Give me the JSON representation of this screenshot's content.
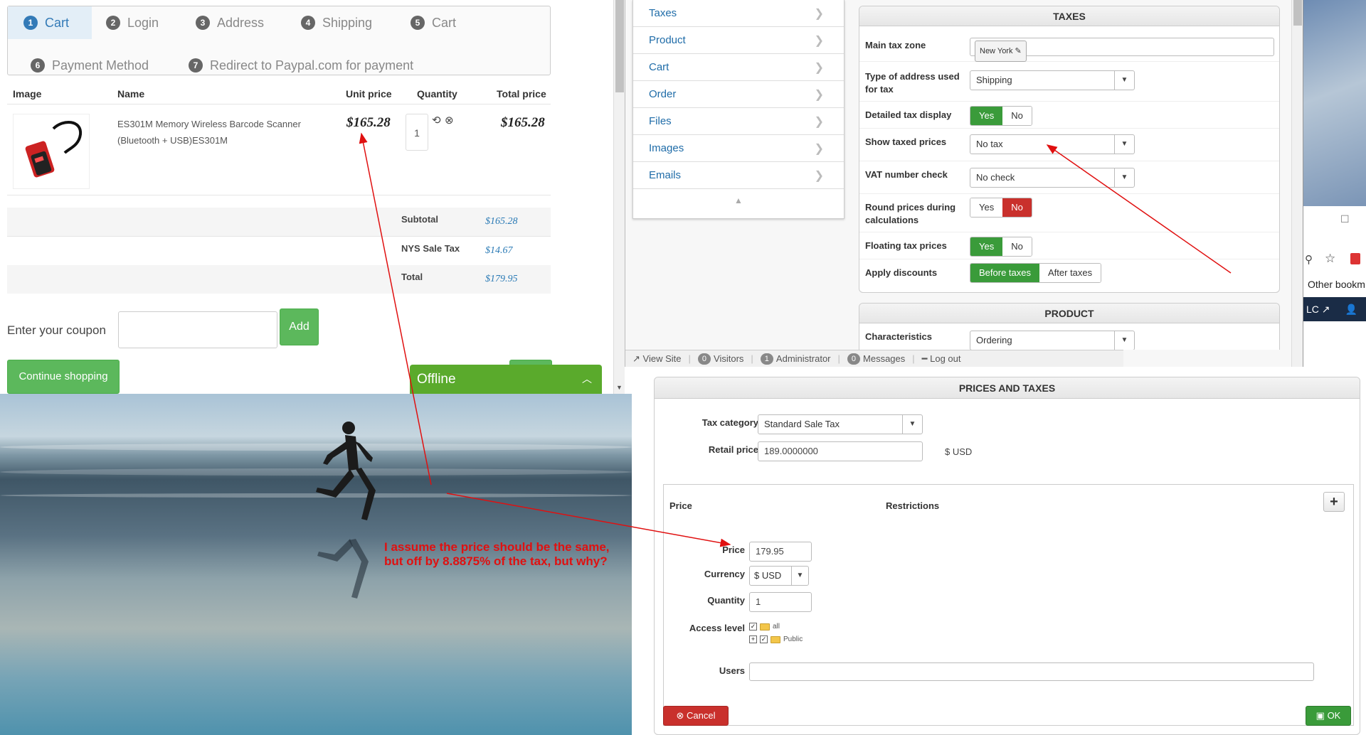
{
  "cart": {
    "steps": [
      {
        "num": "1",
        "label": "Cart"
      },
      {
        "num": "2",
        "label": "Login"
      },
      {
        "num": "3",
        "label": "Address"
      },
      {
        "num": "4",
        "label": "Shipping"
      },
      {
        "num": "5",
        "label": "Cart"
      },
      {
        "num": "6",
        "label": "Payment Method"
      },
      {
        "num": "7",
        "label": "Redirect to Paypal.com for payment"
      }
    ],
    "columns": {
      "image": "Image",
      "name": "Name",
      "unit_price": "Unit price",
      "quantity": "Quantity",
      "total_price": "Total price"
    },
    "item": {
      "name": "ES301M Memory Wireless Barcode Scanner (Bluetooth + USB)ES301M",
      "unit_price": "$165.28",
      "quantity": "1",
      "total_price": "$165.28"
    },
    "summary": {
      "subtotal_label": "Subtotal",
      "subtotal": "$165.28",
      "tax_label": "NYS Sale Tax",
      "tax": "$14.67",
      "total_label": "Total",
      "total": "$179.95"
    },
    "coupon_label": "Enter your coupon",
    "add_button": "Add",
    "continue_button": "Continue shopping",
    "chat_status": "Offline"
  },
  "admin": {
    "menu": [
      "Taxes",
      "Product",
      "Cart",
      "Order",
      "Files",
      "Images",
      "Emails"
    ],
    "taxes_title": "TAXES",
    "main_tax_zone_label": "Main tax zone",
    "main_tax_zone_value": "New York",
    "address_type_label": "Type of address used for tax",
    "address_type_value": "Shipping",
    "detailed_tax_label": "Detailed tax display",
    "show_taxed_label": "Show taxed prices",
    "show_taxed_value": "No tax",
    "vat_label": "VAT number check",
    "vat_value": "No check",
    "round_label": "Round prices during calculations",
    "floating_label": "Floating tax prices",
    "apply_discounts_label": "Apply discounts",
    "yes": "Yes",
    "no": "No",
    "before_taxes": "Before taxes",
    "after_taxes": "After taxes",
    "product_title": "PRODUCT",
    "characteristics_label": "Characteristics",
    "characteristics_value": "Ordering",
    "status_bar": {
      "view_site": "View Site",
      "visitors_count": "0",
      "visitors": "Visitors",
      "admin_count": "1",
      "admin": "Administrator",
      "messages_count": "0",
      "messages": "Messages",
      "logout": "Log out"
    }
  },
  "browser": {
    "bookmarks": "Other bookm",
    "dark_text": "LC"
  },
  "prices": {
    "title": "PRICES AND TAXES",
    "tax_category_label": "Tax category",
    "tax_category_value": "Standard Sale Tax",
    "retail_price_label": "Retail price",
    "retail_price_value": "189.0000000",
    "retail_currency": "$ USD",
    "col_price": "Price",
    "col_restrictions": "Restrictions",
    "price_label": "Price",
    "price_value": "179.95",
    "currency_label": "Currency",
    "currency_value": "$ USD",
    "quantity_label": "Quantity",
    "quantity_value": "1",
    "access_label": "Access level",
    "access_all": "all",
    "access_public": "Public",
    "users_label": "Users",
    "cancel": "Cancel",
    "ok": "OK"
  },
  "annotation": {
    "line1": "I assume the price should be the same,",
    "line2": "but off by 8.8875% of the tax, but why?"
  },
  "colors": {
    "annotation": "#e01010",
    "green": "#3a9b3a",
    "red": "#c9302c",
    "link": "#1f6ca8"
  }
}
